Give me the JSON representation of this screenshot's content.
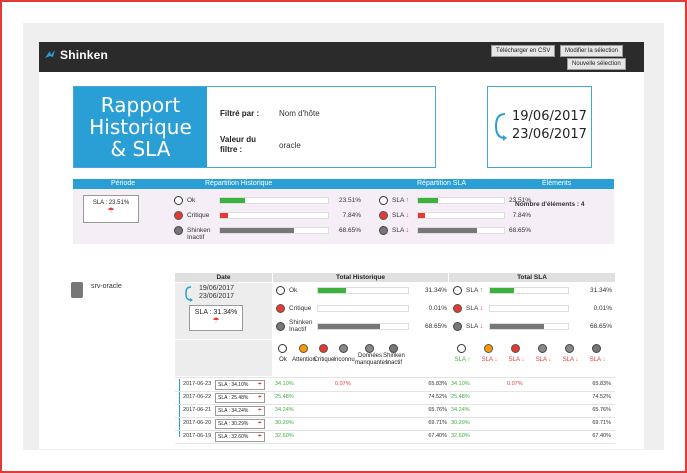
{
  "header": {
    "logo_text": "Shinken",
    "btn_csv": "Télécharger en CSV",
    "btn_modify": "Modifier la sélection",
    "btn_new": "Nouvelle sélection",
    "logo_color": "#2a9fd6"
  },
  "title": {
    "lines": [
      "Rapport",
      "Historique",
      "& SLA"
    ],
    "filter_label": "Filtré par :",
    "filter_value": "Nom d'hôte",
    "filter_value_label_1": "Valeur du",
    "filter_value_label_2": "filtre :",
    "filter_value_value": "oracle"
  },
  "dates": {
    "start": "19/06/2017",
    "end": "23/06/2017"
  },
  "summary": {
    "headers": {
      "period": "Période",
      "hist": "Répartition Historique",
      "sla": "Répartition SLA",
      "elements": "Éléments"
    },
    "sla_chip": "SLA : 23.51%",
    "hist": [
      {
        "label": "Ok",
        "pct": "23.51%",
        "fill": 0.2351,
        "color": "#3bb23b",
        "icon": "ok-icon"
      },
      {
        "label": "Critique",
        "pct": "7.84%",
        "fill": 0.0784,
        "color": "#e53935",
        "icon": "critical-icon"
      },
      {
        "label": "Shinken Inactif",
        "pct": "68.65%",
        "fill": 0.6865,
        "color": "#777777",
        "icon": "inactive-icon"
      }
    ],
    "sla": [
      {
        "label": "SLA",
        "arrow": "↑",
        "pct": "23.51%",
        "fill": 0.2351,
        "color": "#3bb23b",
        "icon": "ok-icon"
      },
      {
        "label": "SLA",
        "arrow": "↓",
        "pct": "7.84%",
        "fill": 0.0784,
        "color": "#e53935",
        "icon": "critical-icon"
      },
      {
        "label": "SLA",
        "arrow": "↓",
        "pct": "68.65%",
        "fill": 0.6865,
        "color": "#777777",
        "icon": "inactive-icon"
      }
    ],
    "elements": "Nombre d'éléments : 4"
  },
  "host": {
    "name": "srv-oracle",
    "head_date": "Date",
    "head_hist": "Total Historique",
    "head_sla": "Total SLA",
    "date_start": "19/06/2017",
    "date_end": "23/06/2017",
    "sla_chip": "SLA : 31.34%",
    "hist": [
      {
        "label": "Ok",
        "pct": "31.34%",
        "fill": 0.3134,
        "color": "#3bb23b"
      },
      {
        "label": "Critique",
        "pct": "0.01%",
        "fill": 0.0001,
        "color": "#e53935"
      },
      {
        "label": "Shinken Inactif",
        "pct": "68.65%",
        "fill": 0.6865,
        "color": "#777777"
      }
    ],
    "sla": [
      {
        "label": "SLA",
        "arrow": "↑",
        "pct": "31.34%",
        "fill": 0.3134,
        "color": "#3bb23b"
      },
      {
        "label": "SLA",
        "arrow": "↓",
        "pct": "0.01%",
        "fill": 0.0001,
        "color": "#e53935"
      },
      {
        "label": "SLA",
        "arrow": "↓",
        "pct": "68.65%",
        "fill": 0.6865,
        "color": "#777777"
      }
    ],
    "status_cols": [
      "Ok",
      "Attention",
      "Critique",
      "Inconnu",
      "Données manquantes",
      "Shinken Inactif"
    ],
    "sla_cols": [
      "SLA ↑",
      "SLA ↓",
      "SLA ↓",
      "SLA ↓",
      "SLA ↓",
      "SLA ↓"
    ],
    "rows": [
      {
        "date": "2017-06-23",
        "sla": "SLA : 34.10%",
        "ok": "34.10%",
        "crit": "0.07%",
        "inact": "65.83%",
        "sla_ok": "34.10%",
        "sla_crit": "0.07%",
        "sla_inact": "65.83%"
      },
      {
        "date": "2017-06-22",
        "sla": "SLA : 25.48%",
        "ok": "25.48%",
        "crit": "",
        "inact": "74.52%",
        "sla_ok": "25.48%",
        "sla_crit": "",
        "sla_inact": "74.52%"
      },
      {
        "date": "2017-06-21",
        "sla": "SLA : 34.24%",
        "ok": "34.24%",
        "crit": "",
        "inact": "65.76%",
        "sla_ok": "34.24%",
        "sla_crit": "",
        "sla_inact": "65.76%"
      },
      {
        "date": "2017-06-20",
        "sla": "SLA : 30.29%",
        "ok": "30.29%",
        "crit": "",
        "inact": "69.71%",
        "sla_ok": "30.29%",
        "sla_crit": "",
        "sla_inact": "69.71%"
      },
      {
        "date": "2017-06-19",
        "sla": "SLA : 32.60%",
        "ok": "32.60%",
        "crit": "",
        "inact": "67.40%",
        "sla_ok": "32.60%",
        "sla_crit": "",
        "sla_inact": "67.40%"
      }
    ]
  }
}
